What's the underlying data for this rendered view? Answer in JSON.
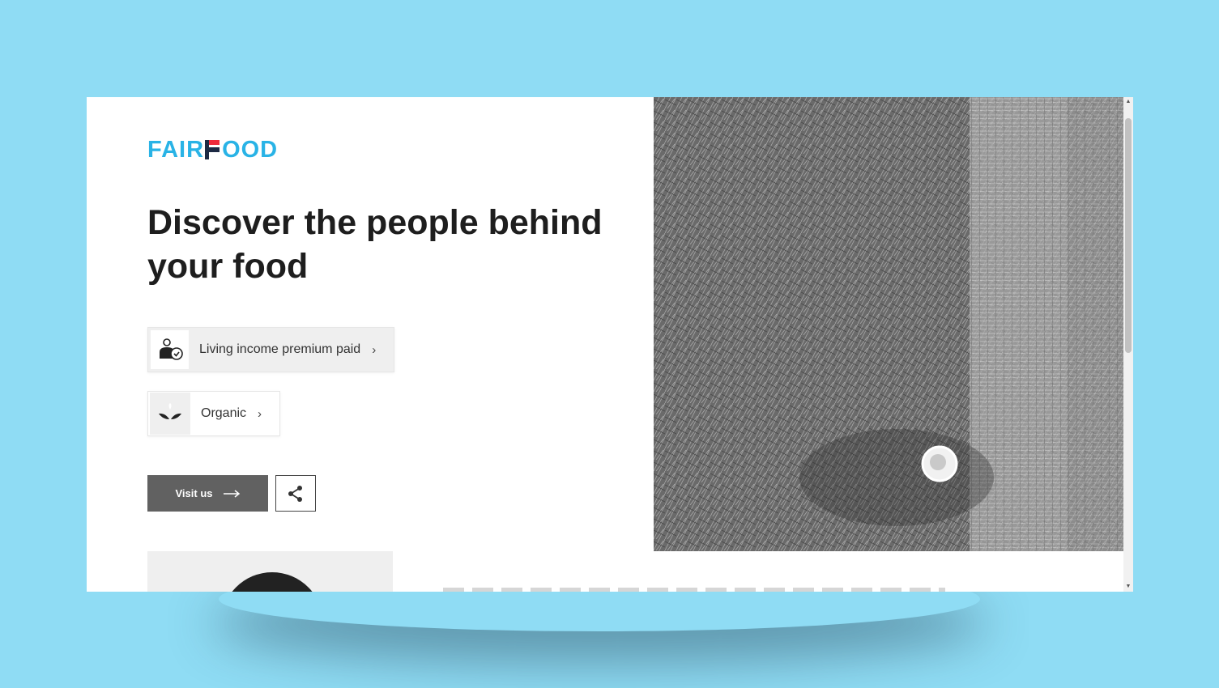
{
  "brand": {
    "logo_left": "FAIR",
    "logo_right": "OOD",
    "colors": {
      "blue": "#29b3e6",
      "red": "#ef2b3c",
      "navy": "#1d2a44"
    }
  },
  "hero": {
    "headline": "Discover the people behind your food",
    "image_desc_icon": "grass-field-photo"
  },
  "badges": [
    {
      "label": "Living income premium paid",
      "icon": "farmer-income-icon"
    },
    {
      "label": "Organic",
      "icon": "leaf-icon"
    }
  ],
  "actions": {
    "visit_label": "Visit us",
    "share_icon": "share-icon"
  },
  "colors": {
    "background": "#8fdcf4",
    "button": "#616161"
  }
}
